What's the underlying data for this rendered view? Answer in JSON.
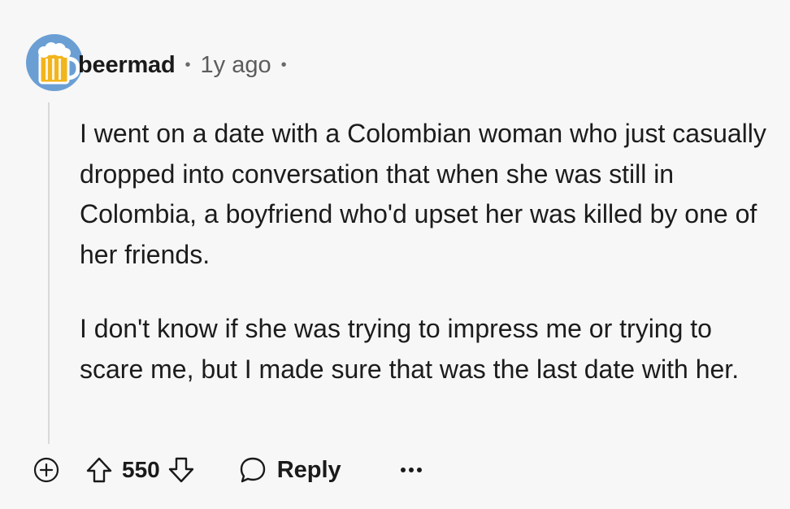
{
  "comment": {
    "author": "beermad",
    "separator": "•",
    "timestamp": "1y ago",
    "paragraphs": [
      "I went on a date with a Colombian woman who just casually dropped into conversation that when she was still in Colombia, a boyfriend who'd upset her was killed by one of her friends.",
      "I don't know if she was trying to impress me or trying to scare me, but I made sure that was the last date with her."
    ],
    "avatar_icon": "beer-mug-icon",
    "avatar_color": "#6b9fd4"
  },
  "actions": {
    "expand_icon": "plus-circle-icon",
    "upvote_icon": "arrow-up-icon",
    "score": "550",
    "downvote_icon": "arrow-down-icon",
    "reply_icon": "speech-bubble-icon",
    "reply_label": "Reply",
    "more_icon": "ellipsis-icon"
  }
}
